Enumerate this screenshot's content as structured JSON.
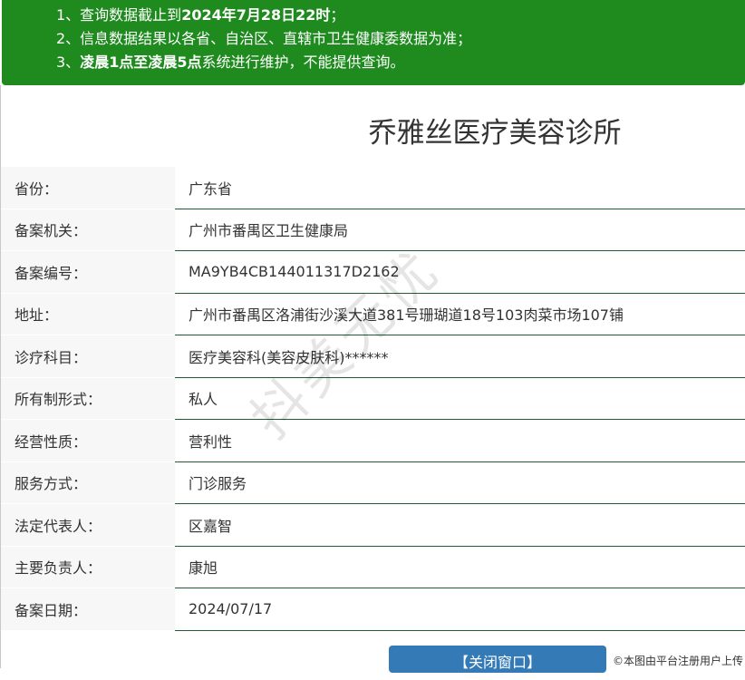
{
  "notice": {
    "lines": [
      {
        "pre": "1、查询数据截止到",
        "bold": "2024年7月28日22时",
        "post": "；"
      },
      {
        "pre": "2、信息数据结果以各省、自治区、直辖市卫生健康委数据为准；",
        "bold": "",
        "post": ""
      },
      {
        "pre": "3、",
        "bold": "凌晨1点至凌晨5点",
        "post": "系统进行维护，不能提供查询。"
      }
    ]
  },
  "title": "乔雅丝医疗美容诊所",
  "rows": [
    {
      "label": "省份：",
      "value": "广东省"
    },
    {
      "label": "备案机关：",
      "value": "广州市番禺区卫生健康局"
    },
    {
      "label": "备案编号：",
      "value": "MA9YB4CB144011317D2162"
    },
    {
      "label": "地址：",
      "value": "广州市番禺区洛浦街沙溪大道381号珊瑚道18号103肉菜市场107铺"
    },
    {
      "label": "诊疗科目：",
      "value": "医疗美容科(美容皮肤科)******"
    },
    {
      "label": "所有制形式：",
      "value": "私人"
    },
    {
      "label": "经营性质：",
      "value": "营利性"
    },
    {
      "label": "服务方式：",
      "value": "门诊服务"
    },
    {
      "label": "法定代表人：",
      "value": "区嘉智"
    },
    {
      "label": "主要负责人：",
      "value": "康旭"
    },
    {
      "label": "备案日期：",
      "value": "2024/07/17"
    }
  ],
  "close_button": "【关闭窗口】",
  "watermark": "抖美无忧",
  "credit": "©本图由平台注册用户上传",
  "colors": {
    "notice_bg": "#1f8b1f",
    "button_bg": "#337ab7",
    "row_line": "#1f5c3a"
  }
}
